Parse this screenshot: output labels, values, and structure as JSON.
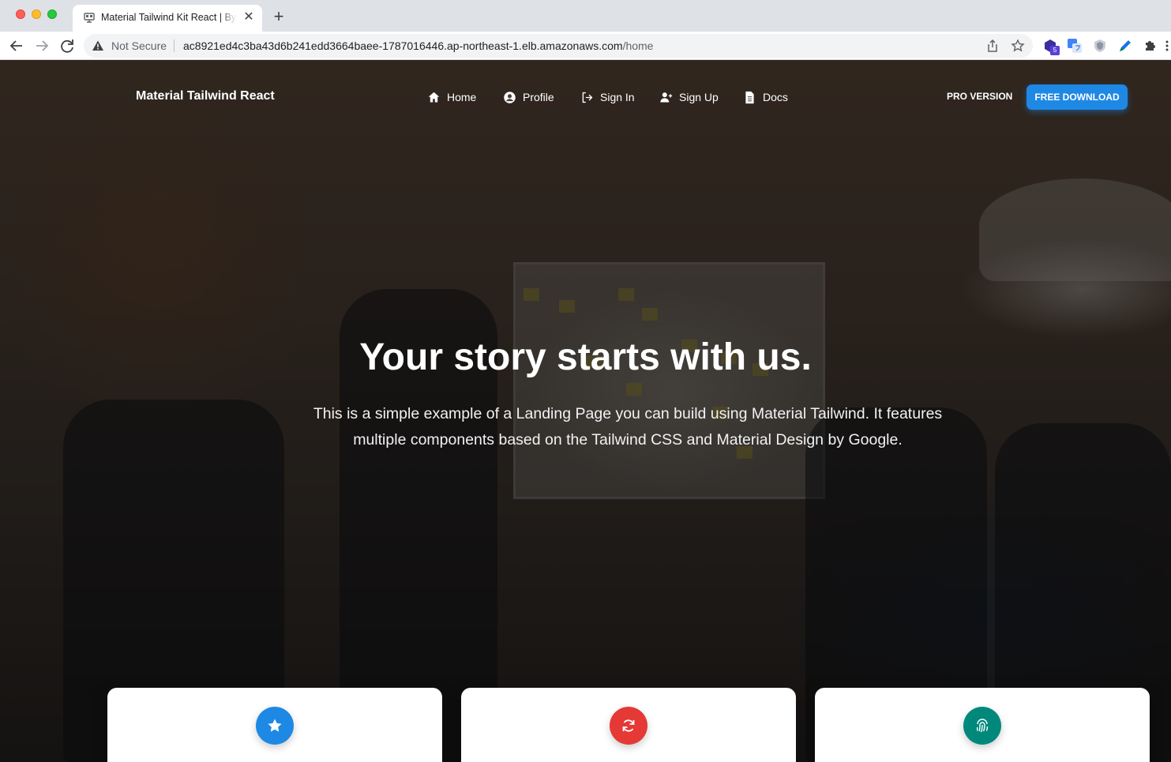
{
  "browser": {
    "tab_title": "Material Tailwind Kit React | By",
    "security_label": "Not Secure",
    "url_host": "ac8921ed4c3ba43d6b241edd3664baee-1787016446.ap-northeast-1.elb.amazonaws.com",
    "url_path": "/home",
    "extension_badge": "5"
  },
  "navbar": {
    "brand": "Material Tailwind React",
    "links": [
      {
        "label": "Home",
        "icon": "home-icon"
      },
      {
        "label": "Profile",
        "icon": "user-circle-icon"
      },
      {
        "label": "Sign In",
        "icon": "sign-in-icon"
      },
      {
        "label": "Sign Up",
        "icon": "user-plus-icon"
      },
      {
        "label": "Docs",
        "icon": "document-icon"
      }
    ],
    "pro_label": "PRO VERSION",
    "download_label": "FREE DOWNLOAD"
  },
  "hero": {
    "headline": "Your story starts with us.",
    "subtext": "This is a simple example of a Landing Page you can build using Material Tailwind. It features multiple components based on the Tailwind CSS and Material Design by Google."
  },
  "features": [
    {
      "icon": "star-icon",
      "color": "#1e88e5"
    },
    {
      "icon": "refresh-icon",
      "color": "#e53935"
    },
    {
      "icon": "fingerprint-icon",
      "color": "#00897b"
    }
  ],
  "colors": {
    "accent": "#1e88e5",
    "chrome_bg": "#dee1e6"
  }
}
